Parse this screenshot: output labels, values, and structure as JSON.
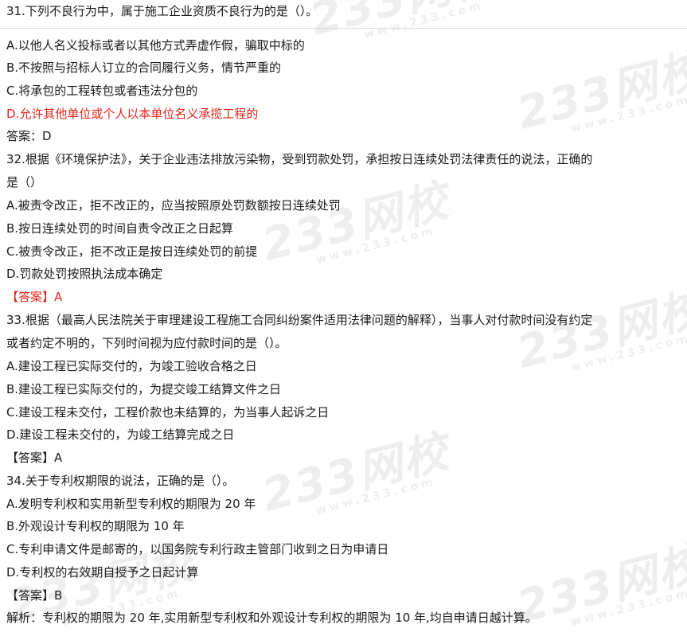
{
  "watermark": "233网校",
  "watermark_sub": "www.233.com",
  "lines": [
    "31.下列不良行为中，属于施工企业资质不良行为的是（）。",
    "A.以他人名义投标或者以其他方式弄虚作假，骗取中标的",
    "B.不按照与招标人订立的合同履行义务，情节严重的",
    "C.将承包的工程转包或者违法分包的",
    "D.允许其他单位或个人以本单位名义承揽工程的",
    "答案：D",
    "32.根据《环境保护法》，关于企业违法排放污染物，受到罚款处罚，承担按日连续处罚法律责任的说法，正确的",
    "是（）",
    "A.被责令改正，拒不改正的，应当按照原处罚数额按日连续处罚",
    "B.按日连续处罚的时间自责令改正之日起算",
    "C.被责令改正，拒不改正是按日连续处罚的前提",
    "D.罚款处罚按照执法成本确定",
    "【答案】A",
    "33.根据（最高人民法院关于审理建设工程施工合同纠纷案件适用法律问题的解释），当事人对付款时间没有约定",
    "或者约定不明的，下列时间视为应付款时间的是（）。",
    "A.建设工程已实际交付的，为竣工验收合格之日",
    "B.建设工程已实际交付的，为提交竣工结算文件之日",
    "C.建设工程未交付，工程价款也未结算的，为当事人起诉之日",
    "D.建设工程未交付的，为竣工结算完成之日",
    "【答案】A",
    "34.关于专利权期限的说法，正确的是（）。",
    "A.发明专利权和实用新型专利权的期限为 20 年",
    "B.外观设计专利权的期限为 10 年",
    "C.专利申请文件是邮寄的，以国务院专利行政主管部门收到之日为申请日",
    "D.专利权的右效期自授予之日起计算",
    "【答案】B",
    "解析：专利权的期限为 20 年,实用新型专利权和外观设计专利权的期限为 10 年,均自申请日越计算。"
  ]
}
